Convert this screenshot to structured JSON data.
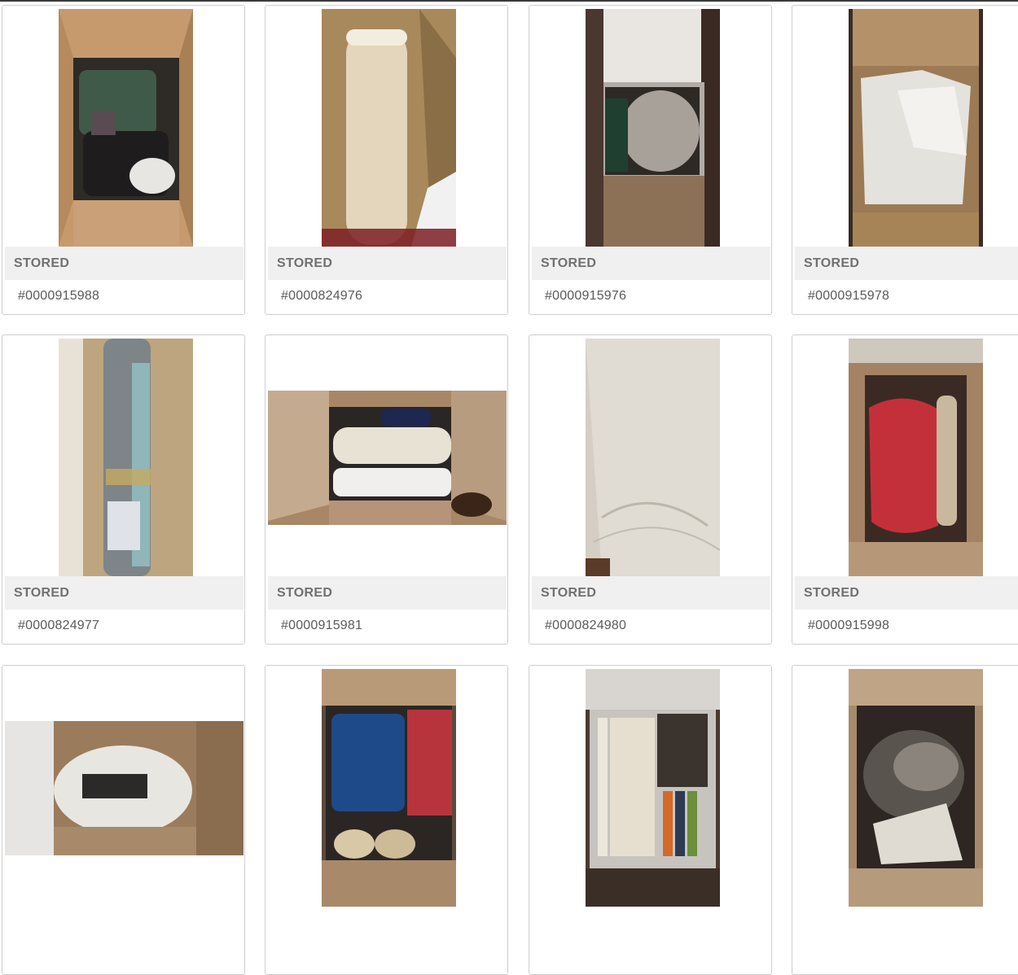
{
  "items": [
    {
      "status": "STORED",
      "id": "#0000915988",
      "photo": "box-clothing-photo"
    },
    {
      "status": "STORED",
      "id": "#0000824976",
      "photo": "rolled-rug-photo"
    },
    {
      "status": "STORED",
      "id": "#0000915976",
      "photo": "box-blanket-photo"
    },
    {
      "status": "STORED",
      "id": "#0000915978",
      "photo": "box-paper-photo"
    },
    {
      "status": "STORED",
      "id": "#0000824977",
      "photo": "rolled-mat-photo"
    },
    {
      "status": "STORED",
      "id": "#0000915981",
      "photo": "box-towels-photo"
    },
    {
      "status": "STORED",
      "id": "#0000824980",
      "photo": "mattress-photo"
    },
    {
      "status": "STORED",
      "id": "#0000915998",
      "photo": "box-red-fabric-photo"
    },
    {
      "status": "",
      "id": "",
      "photo": "box-packing-paper-photo"
    },
    {
      "status": "",
      "id": "",
      "photo": "box-blue-bags-photo"
    },
    {
      "status": "",
      "id": "",
      "photo": "bin-books-photo"
    },
    {
      "status": "",
      "id": "",
      "photo": "box-fur-photo"
    }
  ],
  "colors": {
    "status_bg": "#f0f0f0",
    "status_text": "#707070",
    "id_text": "#5a5a5a",
    "card_border": "#cfcfcf"
  }
}
